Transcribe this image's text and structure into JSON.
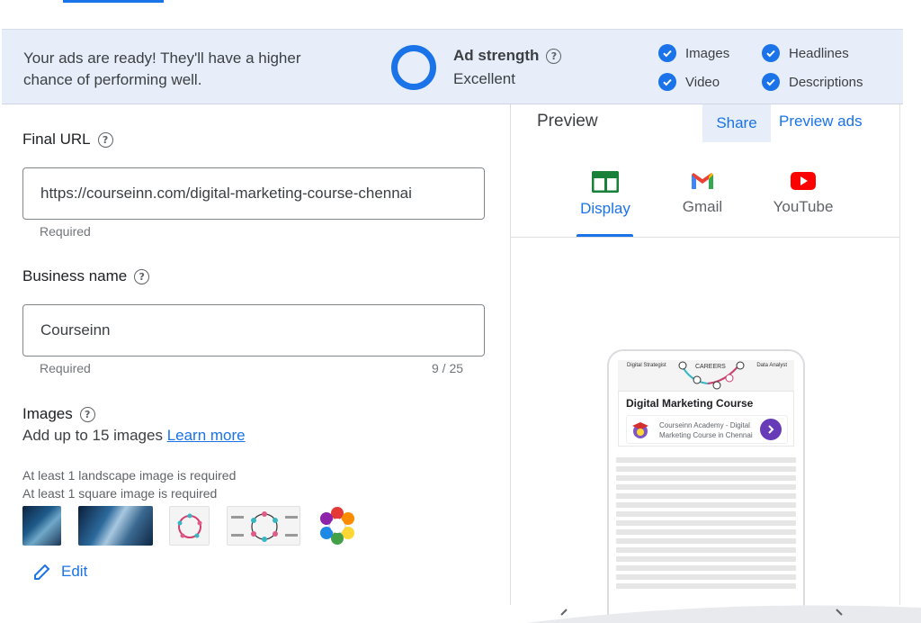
{
  "banner": {
    "message": "Your ads are ready! They'll have a higher chance of performing well.",
    "strength_label": "Ad strength",
    "strength_value": "Excellent",
    "checks": [
      {
        "label": "Images"
      },
      {
        "label": "Headlines"
      },
      {
        "label": "Video"
      },
      {
        "label": "Descriptions"
      }
    ]
  },
  "form": {
    "final_url_label": "Final URL",
    "final_url_value": "https://courseinn.com/digital-marketing-course-chennai",
    "final_url_helper": "Required",
    "business_name_label": "Business name",
    "business_name_value": "Courseinn",
    "business_name_helper": "Required",
    "business_name_count": "9 / 25",
    "images_label": "Images",
    "images_sub": "Add up to 15 images",
    "learn_more": "Learn more",
    "req_landscape": "At least 1 landscape image is required",
    "req_square": "At least 1 square image is required",
    "edit_label": "Edit"
  },
  "preview": {
    "title": "Preview",
    "share": "Share",
    "preview_ads": "Preview ads",
    "tabs": [
      {
        "label": "Display",
        "icon": "display-icon",
        "active": true
      },
      {
        "label": "Gmail",
        "icon": "gmail-icon",
        "active": false
      },
      {
        "label": "YouTube",
        "icon": "youtube-icon",
        "active": false
      }
    ],
    "phone": {
      "banner_left": "Digital Strategist",
      "banner_center": "CAREERS",
      "banner_right": "Data Analyst",
      "ad_title": "Digital Marketing Course",
      "ad_desc": "Courseinn Academy - Digital Marketing Course in Chennai"
    }
  },
  "colors": {
    "accent": "#1a73e8",
    "banner_bg": "#e8eef9",
    "arrow_button": "#673ab7"
  }
}
